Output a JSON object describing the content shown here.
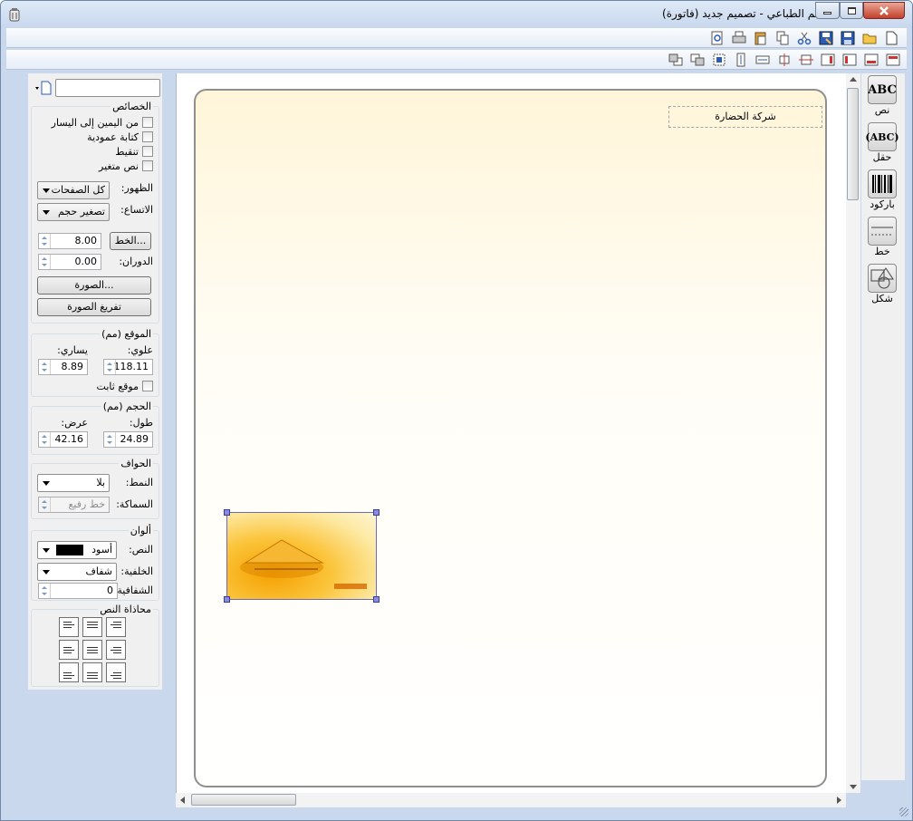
{
  "window": {
    "title": "المصمم الطباعي - تصميم جديد (فاتورة)"
  },
  "toolbar": {
    "main_icons": [
      "new-icon",
      "open-icon",
      "save-icon",
      "save-as-icon",
      "cut-icon",
      "copy-icon",
      "paste-icon",
      "print-icon",
      "print-preview-icon"
    ],
    "align_icons": [
      "align-top-icon",
      "align-bottom-icon",
      "align-left-icon",
      "align-right-icon",
      "center-horizontal-icon",
      "center-vertical-icon",
      "same-width-icon",
      "same-height-icon",
      "same-size-icon",
      "bring-front-icon",
      "send-back-icon"
    ]
  },
  "properties": {
    "title": "الخصائص",
    "rtl_label": "من اليمين إلى اليسار",
    "vertical_label": "كتابة عمودية",
    "dotted_label": "تنقيط",
    "variable_label": "نص متغير",
    "visibility_label": "الظهور:",
    "visibility_value": "كل الصفحات",
    "stretch_label": "الاتساع:",
    "stretch_value": "تصغير حجم",
    "font_button": "الخط...",
    "font_size": "8.00",
    "rotation_label": "الدوران:",
    "rotation_value": "0.00",
    "image_button": "الصورة...",
    "clear_image_button": "تفريغ الصورة"
  },
  "position": {
    "title": "الموقع (مم)",
    "top_label": "علوي:",
    "left_label": "يساري:",
    "top_value": "118.11",
    "left_value": "8.89",
    "fixed_label": "موقع ثابت"
  },
  "size": {
    "title": "الحجم (مم)",
    "height_label": "طول:",
    "width_label": "عرض:",
    "height_value": "24.89",
    "width_value": "42.16"
  },
  "borders": {
    "title": "الحواف",
    "style_label": "النمط:",
    "style_value": "بلا",
    "thickness_label": "السماكة:",
    "thickness_value": "خط رفيع"
  },
  "colors": {
    "title": "ألوان",
    "text_label": "النص:",
    "text_value": "أسود",
    "text_swatch": "#000000",
    "bg_label": "الخلفية:",
    "bg_value": "شفاف",
    "opacity_label": "الشفافية",
    "opacity_value": "0"
  },
  "text_align": {
    "title": "محاذاة النص"
  },
  "canvas": {
    "field_text": "شركة الحضارة"
  },
  "tools": {
    "text_icon_text": "ABC",
    "text_label": "نص",
    "field_icon_text": "(ABC)",
    "field_label": "حقل",
    "barcode_label": "باركود",
    "line_label": "خط",
    "shape_label": "شكل"
  }
}
